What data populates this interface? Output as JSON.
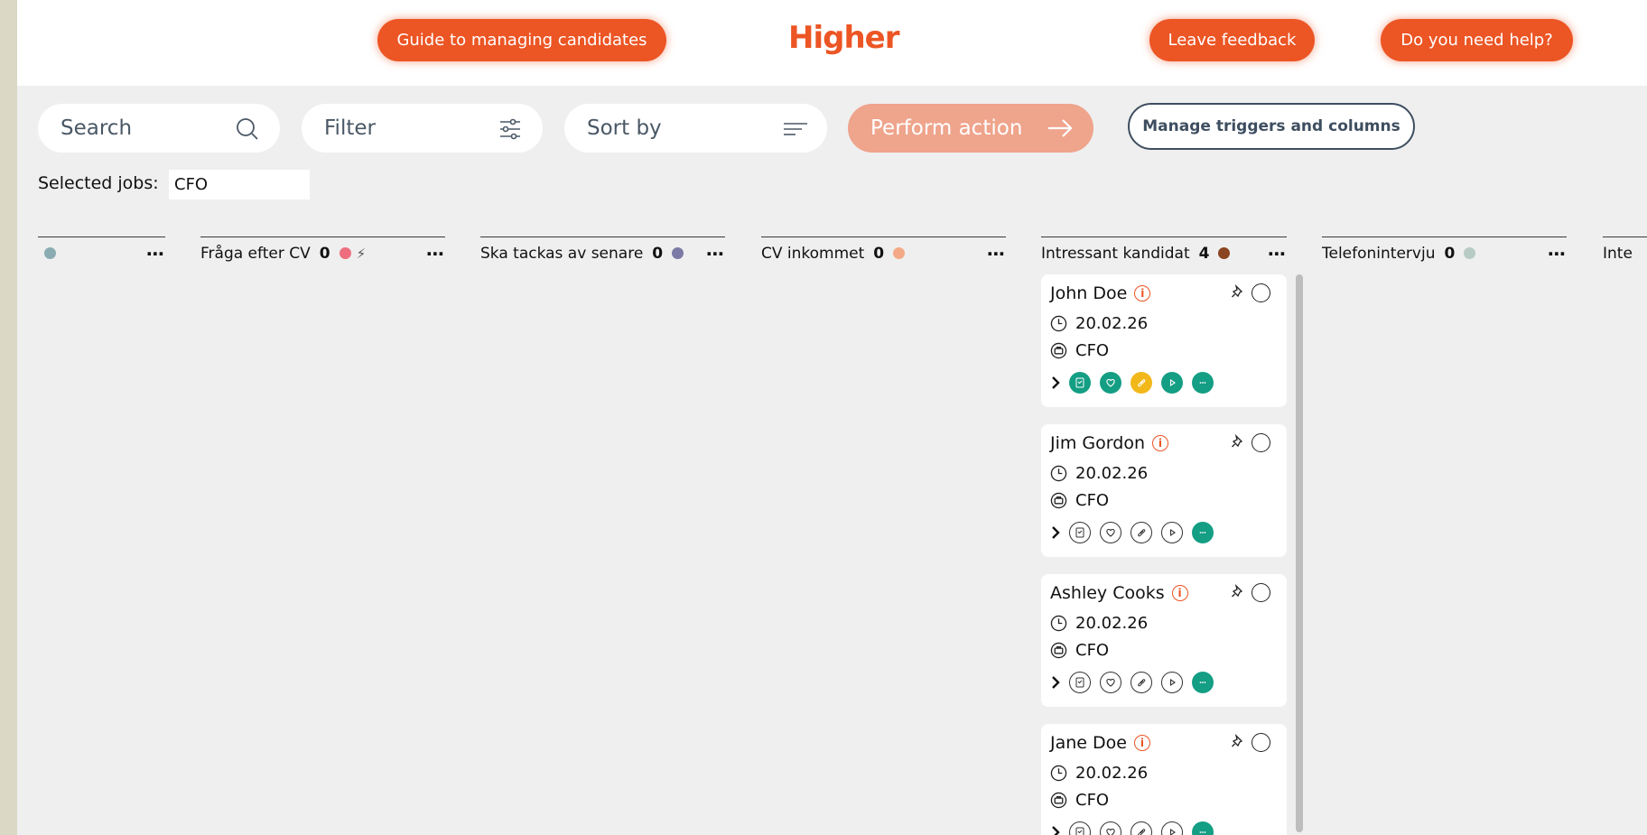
{
  "header": {
    "logo": "Higher",
    "guide_button": "Guide to managing candidates",
    "feedback_button": "Leave feedback",
    "help_button": "Do you need help?"
  },
  "toolbar": {
    "search_placeholder": "Search",
    "filter_label": "Filter",
    "sort_label": "Sort by",
    "perform_action_label": "Perform action",
    "manage_label": "Manage triggers and columns"
  },
  "selected_jobs": {
    "label": "Selected jobs:",
    "value": "CFO"
  },
  "columns": [
    {
      "name": "",
      "count": "",
      "dot_color": "#8aacb2"
    },
    {
      "name": "Fråga efter CV",
      "count": "0",
      "dot_color": "#ee6e80"
    },
    {
      "name": "Ska tackas av senare",
      "count": "0",
      "dot_color": "#7b7aa6"
    },
    {
      "name": "CV inkommet",
      "count": "0",
      "dot_color": "#f3a985"
    },
    {
      "name": "Intressant kandidat",
      "count": "4",
      "dot_color": "#8a4520"
    },
    {
      "name": "Telefonintervju",
      "count": "0",
      "dot_color": "#b7cbc4"
    },
    {
      "name": "Inte",
      "count": "",
      "dot_color": ""
    }
  ],
  "cards": [
    {
      "name": "John Doe",
      "date": "20.02.26",
      "job": "CFO",
      "actions": [
        "on",
        "on",
        "yel",
        "on",
        "on"
      ]
    },
    {
      "name": "Jim Gordon",
      "date": "20.02.26",
      "job": "CFO",
      "actions": [
        "off",
        "off",
        "off",
        "off",
        "on"
      ]
    },
    {
      "name": "Ashley Cooks",
      "date": "20.02.26",
      "job": "CFO",
      "actions": [
        "off",
        "off",
        "off",
        "off",
        "on"
      ]
    },
    {
      "name": "Jane Doe",
      "date": "20.02.26",
      "job": "CFO",
      "actions": [
        "off",
        "off",
        "off",
        "off",
        "on"
      ]
    }
  ],
  "icons": {
    "action_icons": [
      "clipboard-icon",
      "heart-icon",
      "paperclip-icon",
      "play-icon",
      "chat-icon"
    ]
  }
}
